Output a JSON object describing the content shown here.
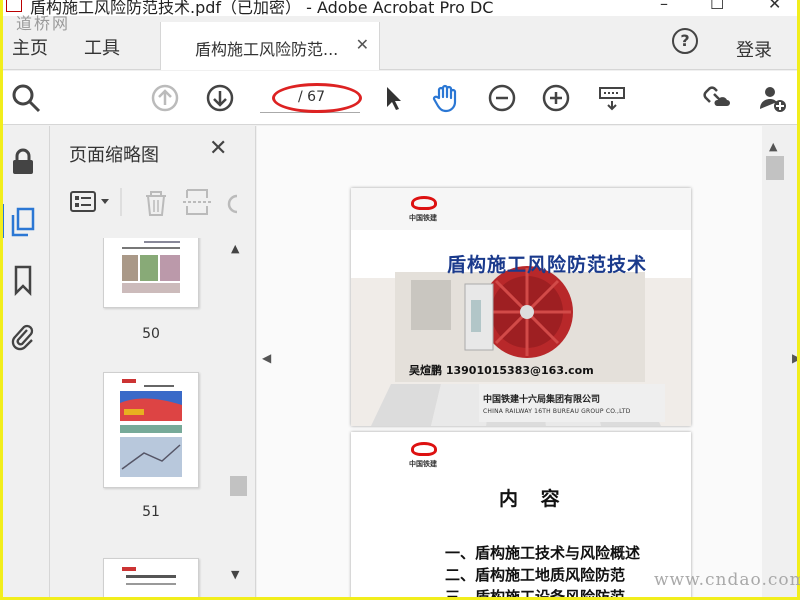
{
  "window": {
    "title": "盾构施工风险防范技术.pdf（已加密） - Adobe Acrobat Pro DC",
    "minimize": "–",
    "maximize": "☐",
    "close": "✕"
  },
  "watermark": {
    "top": "道桥网",
    "bottom": "www.cndao.com"
  },
  "nav": {
    "home": "主页",
    "tools": "工具",
    "tab_label": "盾构施工风险防范...",
    "tab_close": "✕",
    "help": "?",
    "login": "登录"
  },
  "toolbar": {
    "page_indicator": "/ 67",
    "icons": [
      "search-zoom-icon",
      "arrow-up-circle-icon",
      "arrow-down-circle-icon",
      "pointer-icon",
      "hand-icon",
      "zoom-out-icon",
      "zoom-in-icon",
      "keyboard-icon",
      "link-cloud-icon",
      "add-user-icon"
    ]
  },
  "rail": {
    "icons": [
      "lock-icon",
      "pages-icon",
      "bookmark-icon",
      "attachment-icon"
    ]
  },
  "thumbnails": {
    "panel_title": "页面缩略图",
    "close": "✕",
    "items": [
      {
        "label": "50"
      },
      {
        "label": "51"
      }
    ]
  },
  "document": {
    "page1": {
      "logo_caption": "中国铁建",
      "title": "盾构施工风险防范技术",
      "author": "吴煊鹏   13901015383@163.com",
      "org": "中国铁建十六局集团有限公司",
      "org_en": "CHINA RAILWAY 16TH BUREAU GROUP CO.,LTD"
    },
    "page2": {
      "logo_caption": "中国铁建",
      "heading": "内 容",
      "items": [
        "一、盾构施工技术与风险概述",
        "二、盾构施工地质风险防范",
        "三、盾构施工设备风险防范"
      ]
    }
  },
  "colors": {
    "accent": "#2b77d4",
    "frame": "#f2ee1c",
    "ring": "#dd2222"
  }
}
